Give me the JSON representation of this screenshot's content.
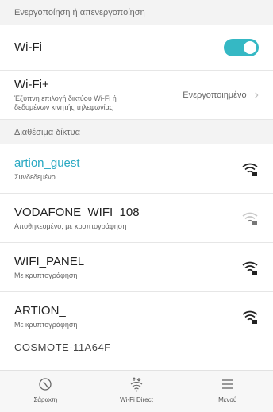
{
  "toggle_section": {
    "header": "Ενεργοποίηση ή απενεργοποίηση",
    "wifi_label": "Wi-Fi",
    "wifi_enabled": true,
    "wifiplus_title": "Wi-Fi+",
    "wifiplus_desc_line1": "Έξυπνη επιλογή δικτύου Wi-Fi ή",
    "wifiplus_desc_line2": "δεδομένων κινητής τηλεφωνίας",
    "wifiplus_value": "Ενεργοποιημένο"
  },
  "networks_section": {
    "header": "Διαθέσιμα δίκτυα",
    "networks": [
      {
        "name": "artion_guest",
        "status": "Συνδεδεμένο",
        "connected": true,
        "signal_icon": "wifi-signal-full-icon"
      },
      {
        "name": "VODAFONE_WIFI_108",
        "status": "Αποθηκευμένο, με κρυπτογράφηση",
        "connected": false,
        "signal_icon": "wifi-signal-weak-icon"
      },
      {
        "name": "WIFI_PANEL",
        "status": "Με κρυπτογράφηση",
        "connected": false,
        "signal_icon": "wifi-signal-full-icon"
      },
      {
        "name": "ARTION_",
        "status": "Με κρυπτογράφηση",
        "connected": false,
        "signal_icon": "wifi-signal-full-icon"
      }
    ],
    "partial_network": "COSMOTE-11A64F"
  },
  "bottom_bar": {
    "scan_label": "Σάρωση",
    "wifi_direct_label": "Wi-Fi Direct",
    "menu_label": "Μενού"
  },
  "colors": {
    "accent": "#35b8c4",
    "connected_text": "#2aa9c3"
  }
}
